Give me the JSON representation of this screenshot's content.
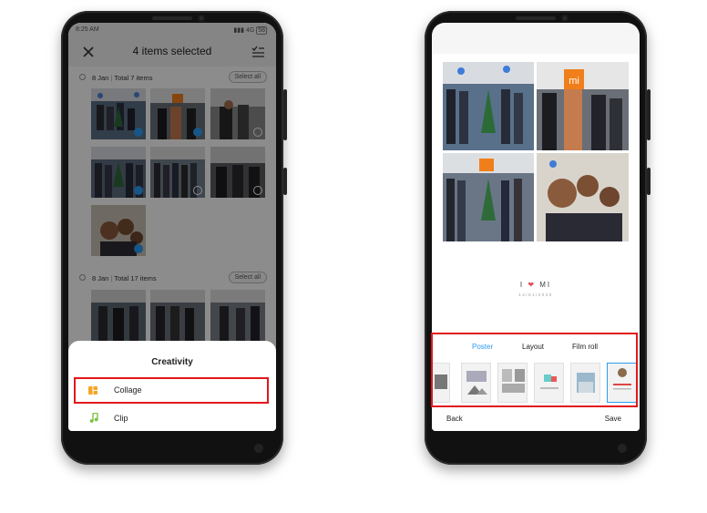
{
  "left_phone": {
    "status": {
      "time": "8:25 AM",
      "network": "4G",
      "battery": "58"
    },
    "header": {
      "title": "4 items selected",
      "close_icon": "close-icon",
      "select_icon": "list-check-icon"
    },
    "sections": [
      {
        "date": "8 Jan",
        "total": "Total 7 items",
        "select_all": "Select all"
      },
      {
        "date": "8 Jan",
        "total": "Total 17 items",
        "select_all": "Select all"
      }
    ],
    "sheet": {
      "title": "Creativity",
      "items": [
        {
          "label": "Collage",
          "icon": "collage-icon",
          "color": "#f5a623"
        },
        {
          "label": "Clip",
          "icon": "music-note-icon",
          "color": "#7ac143"
        }
      ]
    }
  },
  "right_phone": {
    "collage_caption": "I ❤ MI",
    "collage_date": "14/01/2020",
    "tabs": [
      {
        "label": "Poster",
        "active": true
      },
      {
        "label": "Layout",
        "active": false
      },
      {
        "label": "Film roll",
        "active": false
      }
    ],
    "back_label": "Back",
    "save_label": "Save"
  },
  "colors": {
    "accent": "#2a9df4",
    "highlight": "#e3171b",
    "heart": "#e0505a"
  }
}
